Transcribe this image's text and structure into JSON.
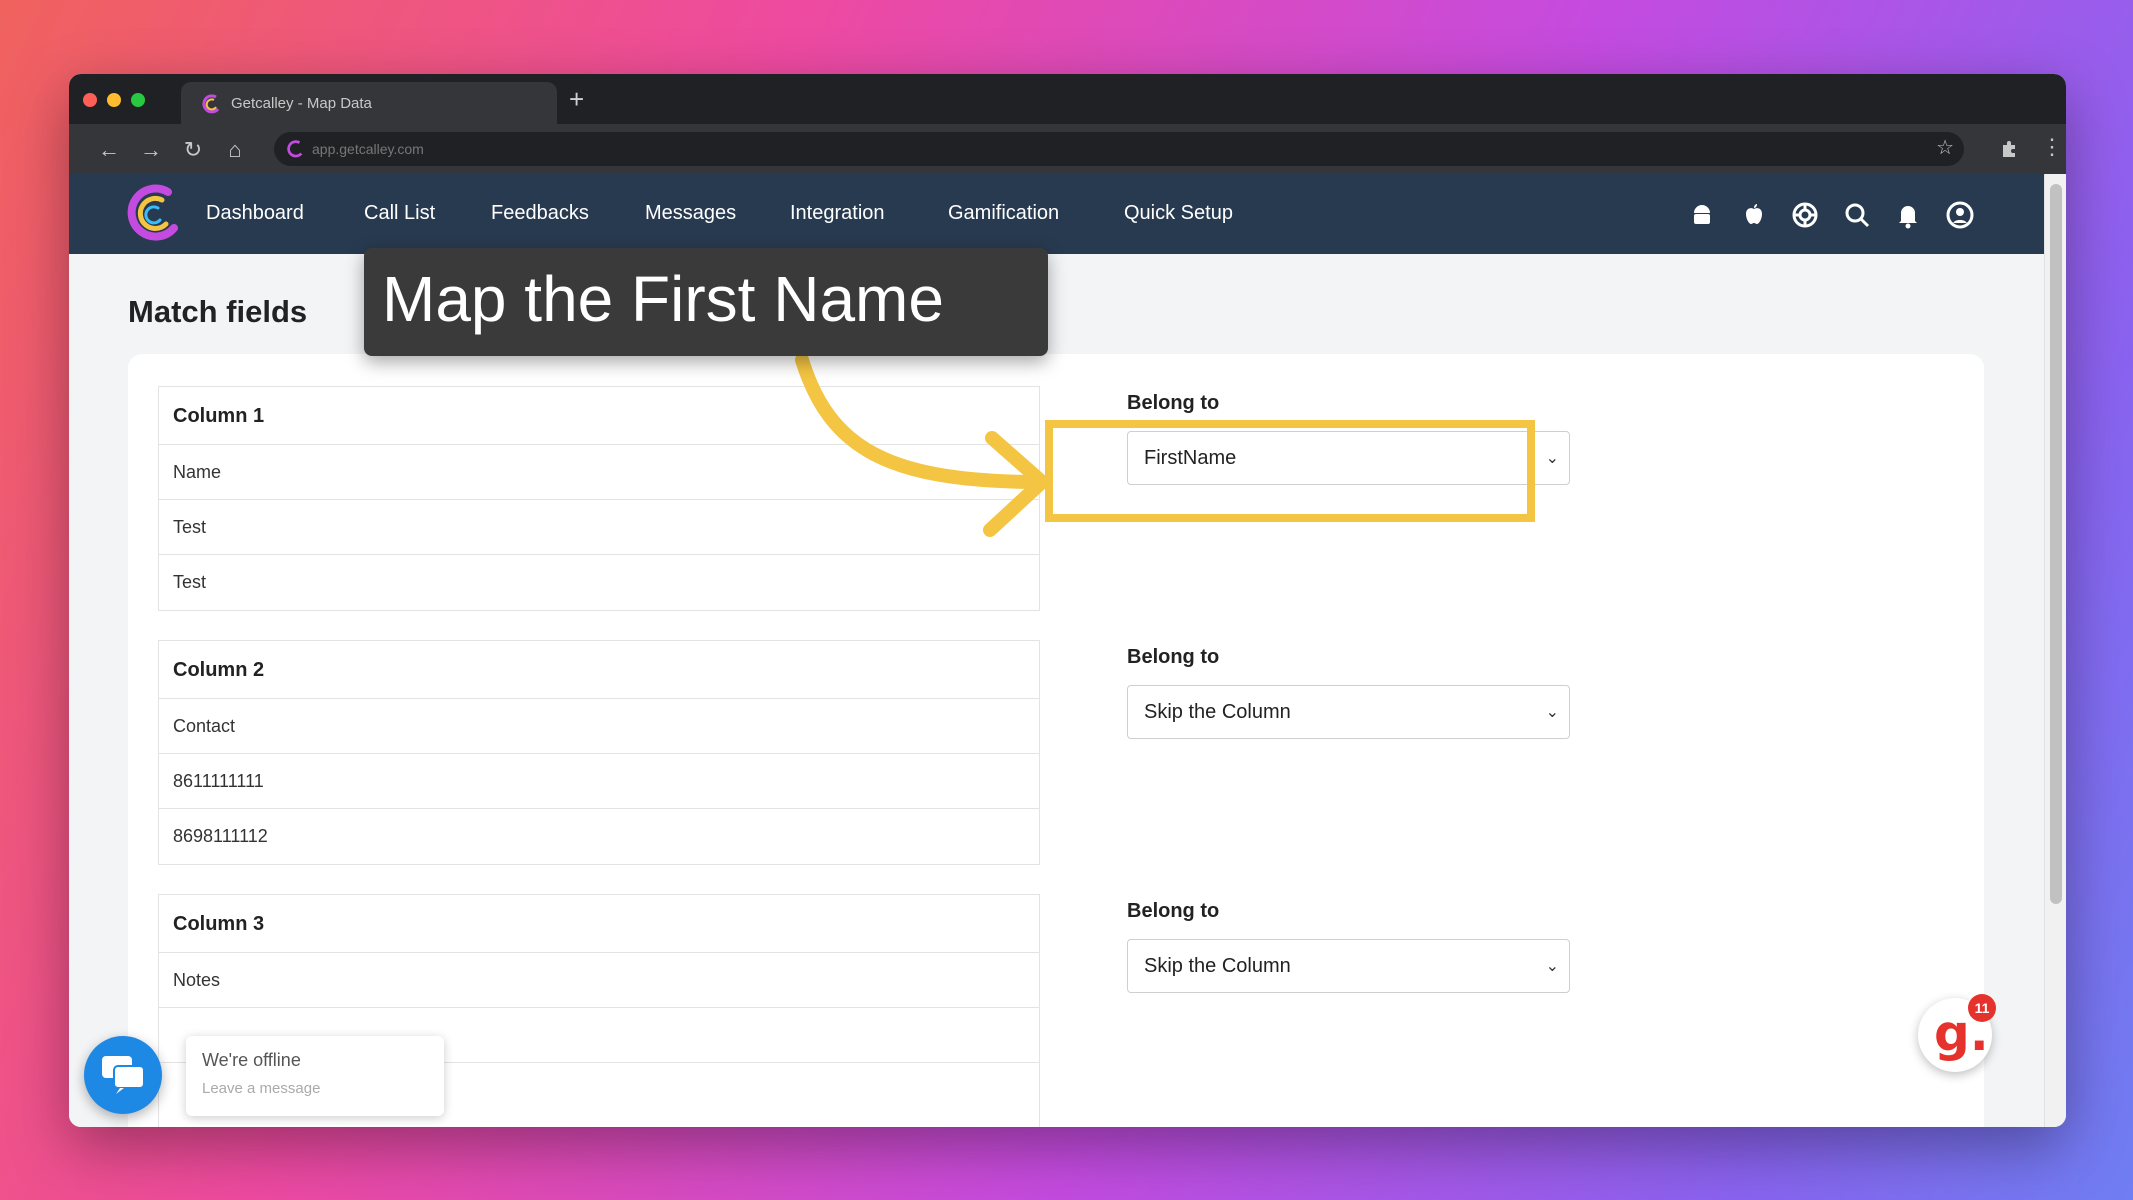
{
  "browser": {
    "tab_title": "Getcalley - Map Data",
    "new_tab": "+",
    "url": "app.getcalley.com",
    "back": "←",
    "forward": "→",
    "reload": "↻",
    "home": "⌂",
    "star": "☆",
    "menu": "⋮",
    "traffic_colors": [
      "#ff5f57",
      "#febc2e",
      "#28c840"
    ]
  },
  "nav": {
    "links": [
      "Dashboard",
      "Call List",
      "Feedbacks",
      "Messages",
      "Integration",
      "Gamification",
      "Quick Setup"
    ],
    "icons": [
      "android-icon",
      "apple-icon",
      "support-icon",
      "search-icon",
      "bell-icon",
      "user-icon"
    ]
  },
  "page": {
    "title": "Match fields"
  },
  "columns": [
    {
      "header": "Column 1",
      "rows": [
        "Name",
        "Test",
        "Test"
      ],
      "belong_label": "Belong to",
      "selected": "FirstName"
    },
    {
      "header": "Column 2",
      "rows": [
        "Contact",
        "8611111111",
        "8698111112"
      ],
      "belong_label": "Belong to",
      "selected": "Skip the Column"
    },
    {
      "header": "Column 3",
      "rows": [
        "Notes",
        "",
        ""
      ],
      "belong_label": "Belong to",
      "selected": "Skip the Column"
    }
  ],
  "tooltip": {
    "text": "Map the First Name"
  },
  "chat": {
    "title": "We're offline",
    "subtitle": "Leave a message"
  },
  "badge": {
    "letter": "g.",
    "count": "11"
  },
  "colors": {
    "nav_bg": "#283a50",
    "highlight": "#f4c542",
    "chat_blue": "#1e88e5",
    "badge_red": "#e5322d"
  }
}
